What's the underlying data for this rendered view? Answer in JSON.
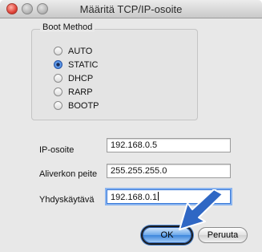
{
  "window": {
    "title": "Määritä TCP/IP-osoite"
  },
  "boot_method": {
    "label": "Boot Method",
    "options": [
      {
        "label": "AUTO",
        "selected": false
      },
      {
        "label": "STATIC",
        "selected": true
      },
      {
        "label": "DHCP",
        "selected": false
      },
      {
        "label": "RARP",
        "selected": false
      },
      {
        "label": "BOOTP",
        "selected": false
      }
    ]
  },
  "fields": {
    "ip": {
      "label": "IP-osoite",
      "value": "192.168.0.5"
    },
    "subnet": {
      "label": "Aliverkon peite",
      "value": "255.255.255.0"
    },
    "gateway": {
      "label": "Yhdyskäytävä",
      "value": "192.168.0.1"
    }
  },
  "buttons": {
    "ok": "OK",
    "cancel": "Peruuta"
  },
  "colors": {
    "accent": "#2c6fd1",
    "arrow": "#2f67c4"
  },
  "icons": {
    "arrow": "pointer-arrow-icon"
  }
}
